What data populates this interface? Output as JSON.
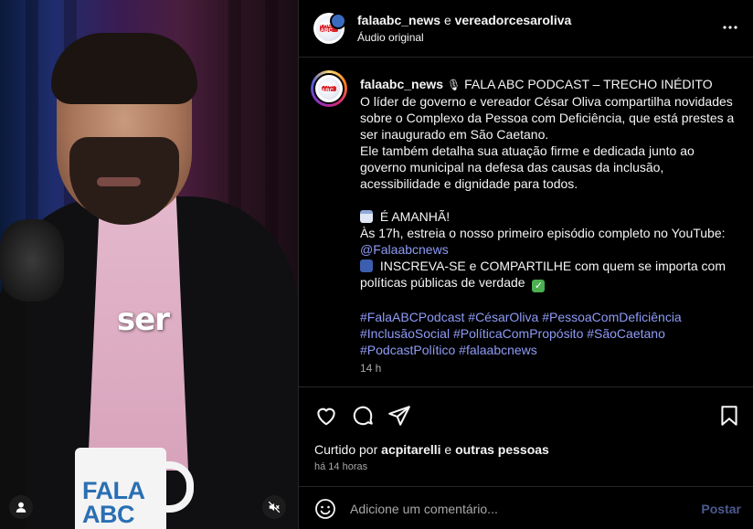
{
  "video": {
    "caption_word": "ser",
    "mug_text_line1": "FALA",
    "mug_text_line2": "ABC",
    "user_icon": "person-icon",
    "mute_icon": "speaker-muted-icon"
  },
  "header": {
    "user1": "falaabc_news",
    "conjunction": "e",
    "user2": "vereadorcesaroliva",
    "subtitle": "Áudio original",
    "logo_text": "FALA ABC",
    "more_icon": "more-horizontal-icon"
  },
  "post": {
    "username": "falaabc_news",
    "title": "FALA ABC PODCAST – TRECHO INÉDITO",
    "para1": [
      "O líder de governo e vereador César Oliva compartilha novidades",
      "sobre o Complexo da Pessoa com Deficiência, que está prestes a",
      "ser inaugurado em São Caetano.",
      "Ele também detalha sua atuação firme e dedicada junto ao",
      "governo municipal na defesa das causas da inclusão,",
      "acessibilidade e dignidade para todos."
    ],
    "announce": "É AMANHÃ!",
    "premiere": "Às 17h, estreia o nosso primeiro episódio completo no YouTube:",
    "channel": "@Falaabcnews",
    "subscribe_line1": "INSCREVA-SE e COMPARTILHE com quem se importa com",
    "subscribe_line2": "políticas públicas de verdade",
    "hashtags": [
      "#FalaABCPodcast #CésarOliva #PessoaComDeficiência",
      "#InclusãoSocial #PolíticaComPropósito #SãoCaetano",
      "#PodcastPolítico #falaabcnews"
    ],
    "time": "14 h"
  },
  "actions": {
    "liked_prefix": "Curtido por",
    "liked_user": "acpitarelli",
    "liked_and": "e",
    "liked_others": "outras pessoas",
    "since": "há 14 horas"
  },
  "comment_box": {
    "placeholder": "Adicione um comentário...",
    "post_label": "Postar"
  },
  "colors": {
    "link": "#8f9bf7",
    "muted": "#a8a8a8",
    "post_disabled": "#4c5a8f"
  }
}
